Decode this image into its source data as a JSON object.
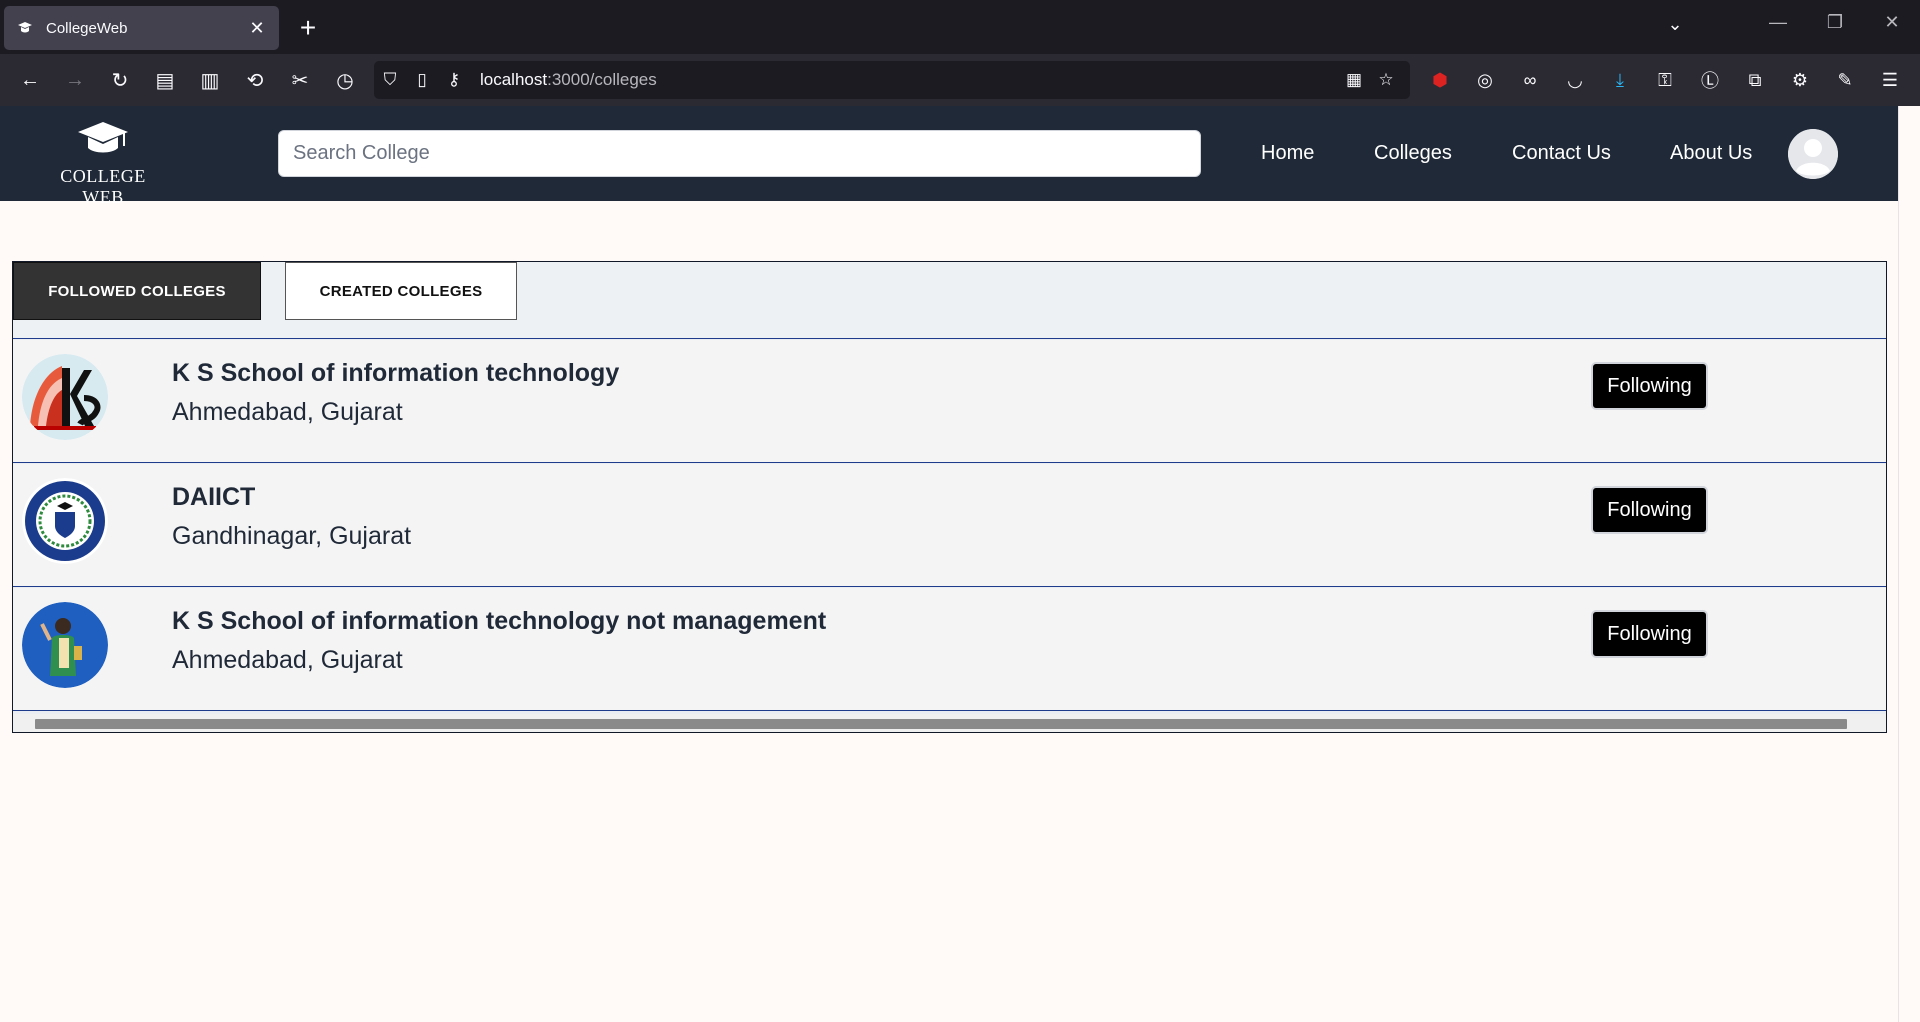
{
  "browser": {
    "tab_title": "CollegeWeb",
    "tab_close": "✕",
    "new_tab": "+",
    "url_host": "localhost",
    "url_path": ":3000/colleges"
  },
  "site": {
    "logo_text": "COLLEGE WEB",
    "search_placeholder": "Search College",
    "nav": {
      "home": "Home",
      "colleges": "Colleges",
      "contact": "Contact Us",
      "about": "About Us"
    }
  },
  "tabs": {
    "followed": "FOLLOWED COLLEGES",
    "created": "CREATED COLLEGES"
  },
  "colleges": [
    {
      "name": "K S School of information technology",
      "location": "Ahmedabad, Gujarat",
      "action": "Following"
    },
    {
      "name": "DAIICT",
      "location": "Gandhinagar, Gujarat",
      "action": "Following"
    },
    {
      "name": "K S School of information technology not management",
      "location": "Ahmedabad, Gujarat",
      "action": "Following"
    }
  ],
  "colors": {
    "header_bg": "#1f2937",
    "row_border": "#1e3a8a",
    "button_bg": "#000000"
  }
}
